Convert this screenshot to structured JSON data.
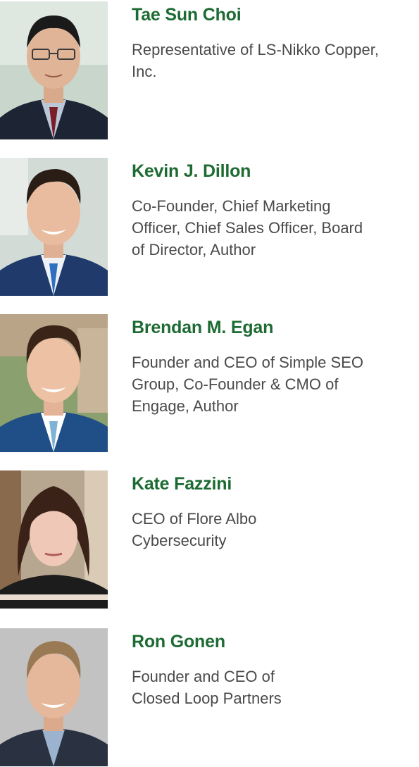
{
  "people": [
    {
      "name": "Tae Sun Choi",
      "role_lines": [
        "Representative of LS-Nikko Copper,",
        "Inc."
      ],
      "photo_icon": "person-photo"
    },
    {
      "name": "Kevin J. Dillon",
      "role_lines": [
        "Co-Founder, Chief Marketing",
        "Officer, Chief Sales Officer, Board",
        "of Director, Author"
      ],
      "photo_icon": "person-photo"
    },
    {
      "name": "Brendan M. Egan",
      "role_lines": [
        "Founder and CEO of Simple SEO",
        "Group, Co-Founder & CMO of",
        "Engage, Author"
      ],
      "photo_icon": "person-photo"
    },
    {
      "name": "Kate Fazzini",
      "role_lines": [
        "CEO of Flore Albo",
        "Cybersecurity"
      ],
      "photo_icon": "person-photo"
    },
    {
      "name": "Ron Gonen",
      "role_lines": [
        "Founder and CEO of",
        "Closed Loop Partners"
      ],
      "photo_icon": "person-photo"
    }
  ],
  "colors": {
    "name": "#1d6b33",
    "role": "#4a4a4a"
  }
}
